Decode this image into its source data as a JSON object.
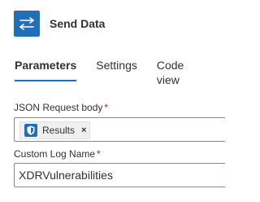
{
  "header": {
    "title": "Send Data",
    "icon": "data-operations-icon",
    "accent": "#1f6fb9"
  },
  "tabs": [
    {
      "label": "Parameters",
      "active": true
    },
    {
      "label": "Settings",
      "active": false
    },
    {
      "label": "Code view",
      "active": false
    }
  ],
  "form": {
    "json_body": {
      "label": "JSON Request body",
      "required_mark": "*",
      "token": {
        "label": "Results",
        "close": "×",
        "icon": "shield-icon"
      }
    },
    "custom_log": {
      "label": "Custom Log Name",
      "required_mark": "*",
      "value": "XDRVulnerabilities"
    }
  }
}
